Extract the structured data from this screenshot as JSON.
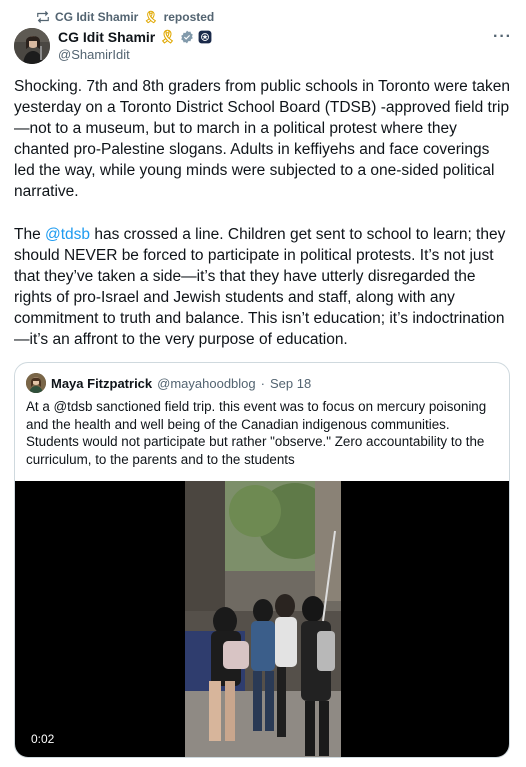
{
  "repost": {
    "icon": "repost-icon",
    "name": "CG Idit Shamir",
    "ribbon": "🎗",
    "label": "reposted"
  },
  "author": {
    "name": "CG Idit Shamir",
    "ribbon": "🎗",
    "handle": "@ShamirIdit"
  },
  "more_label": "···",
  "tweet": {
    "para1": "Shocking.  7th and 8th graders from public schools in Toronto were taken yesterday on a Toronto District School Board (TDSB) -approved field trip—not to a museum, but to march in a political protest where they chanted pro-Palestine slogans. Adults in keffiyehs and face coverings led the way, while young minds were subjected to a one-sided political narrative.",
    "para2_prefix": "The ",
    "para2_mention": "@tdsb",
    "para2_rest": " has crossed a line. Children get sent to school to learn; they should NEVER be forced to participate in political protests. It’s not just that they’ve taken a side—it’s that they have utterly disregarded the rights of pro-Israel and Jewish students and staff, along with any commitment to truth and balance. This isn’t education; it’s indoctrination—it’s an affront to the very purpose of education."
  },
  "quote": {
    "name": "Maya Fitzpatrick",
    "handle": "@mayahoodblog",
    "separator": "·",
    "date": "Sep 18",
    "text": "At a @tdsb sanctioned field trip. this event was to focus on mercury poisoning and the health and well being of the Canadian indigenous communities. Students would not participate but rather \"observe.\"  Zero accountability to the curriculum, to the parents and to the students",
    "video_time": "0:02"
  },
  "colors": {
    "accent": "#1d9bf0",
    "text": "#0f1419",
    "muted": "#536471",
    "border": "#cfd9de"
  }
}
